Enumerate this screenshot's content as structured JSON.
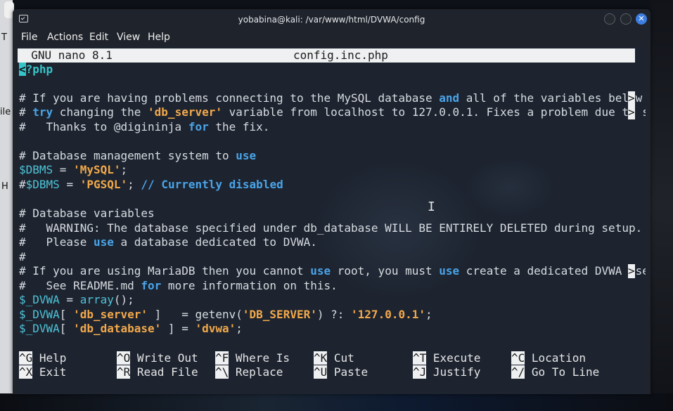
{
  "window": {
    "title": "yobabina@kali: /var/www/html/DVWA/config",
    "close_glyph": "✕"
  },
  "menubar": [
    "File",
    "Actions",
    "Edit",
    "View",
    "Help"
  ],
  "nano": {
    "version": "GNU nano 8.1",
    "filename": "config.inc.php"
  },
  "code": {
    "php_open_mark": "<",
    "php_open_rest": "?php",
    "l3_a": "# If you are having problems connecting to the MySQL database ",
    "l3_b": "and",
    "l3_c": " all of the variables below ",
    "l4_a": "# ",
    "l4_b": "try",
    "l4_c": " changing the ",
    "l4_d": "'db_server'",
    "l4_e": " variable from localhost to 127.0.0.1. Fixes a problem due to s",
    "l5_a": "#   Thanks to @digininja ",
    "l5_b": "for",
    "l5_c": " the fix.",
    "l7_a": "# Database management system to ",
    "l7_b": "use",
    "l8_a": "$DBMS",
    "l8_b": " = ",
    "l8_c": "'MySQL'",
    "l8_d": ";",
    "l9_a": "#",
    "l9_b": "$DBMS",
    "l9_c": " = ",
    "l9_d": "'PGSQL'",
    "l9_e": "; ",
    "l9_f": "// Currently disabled",
    "l11": "# Database variables",
    "l12": "#   WARNING: The database specified under db_database WILL BE ENTIRELY DELETED during setup.",
    "l13_a": "#   Please ",
    "l13_b": "use",
    "l13_c": " a database dedicated to DVWA.",
    "l14": "#",
    "l15_a": "# If you are using MariaDB then you cannot ",
    "l15_b": "use",
    "l15_c": " root, you must ",
    "l15_d": "use",
    "l15_e": " create a dedicated DVWA use",
    "l16_a": "#   See README.md ",
    "l16_b": "for",
    "l16_c": " more information on this.",
    "l17_a": "$_DVWA",
    "l17_b": " = ",
    "l17_c": "array",
    "l17_d": "();",
    "l18_a": "$_DVWA",
    "l18_b": "[ ",
    "l18_c": "'db_server'",
    "l18_d": " ]   = getenv(",
    "l18_e": "'DB_SERVER'",
    "l18_f": ") ?: ",
    "l18_g": "'127.0.0.1'",
    "l18_h": ";",
    "l19_a": "$_DVWA",
    "l19_b": "[ ",
    "l19_c": "'db_database'",
    "l19_d": " ] = ",
    "l19_e": "'dvwa'",
    "l19_f": ";",
    "overflow_mark": ">"
  },
  "shortcuts": [
    {
      "key": "^G",
      "label": "Help"
    },
    {
      "key": "^O",
      "label": "Write Out"
    },
    {
      "key": "^F",
      "label": "Where Is"
    },
    {
      "key": "^K",
      "label": "Cut"
    },
    {
      "key": "^T",
      "label": "Execute"
    },
    {
      "key": "^C",
      "label": "Location"
    },
    {
      "key": "^X",
      "label": "Exit"
    },
    {
      "key": "^R",
      "label": "Read File"
    },
    {
      "key": "^\\",
      "label": "Replace"
    },
    {
      "key": "^U",
      "label": "Paste"
    },
    {
      "key": "^J",
      "label": "Justify"
    },
    {
      "key": "^/",
      "label": "Go To Line"
    }
  ],
  "desktop_left_letters": [
    "T",
    "ile",
    "H"
  ],
  "mouse_cursor": "I"
}
